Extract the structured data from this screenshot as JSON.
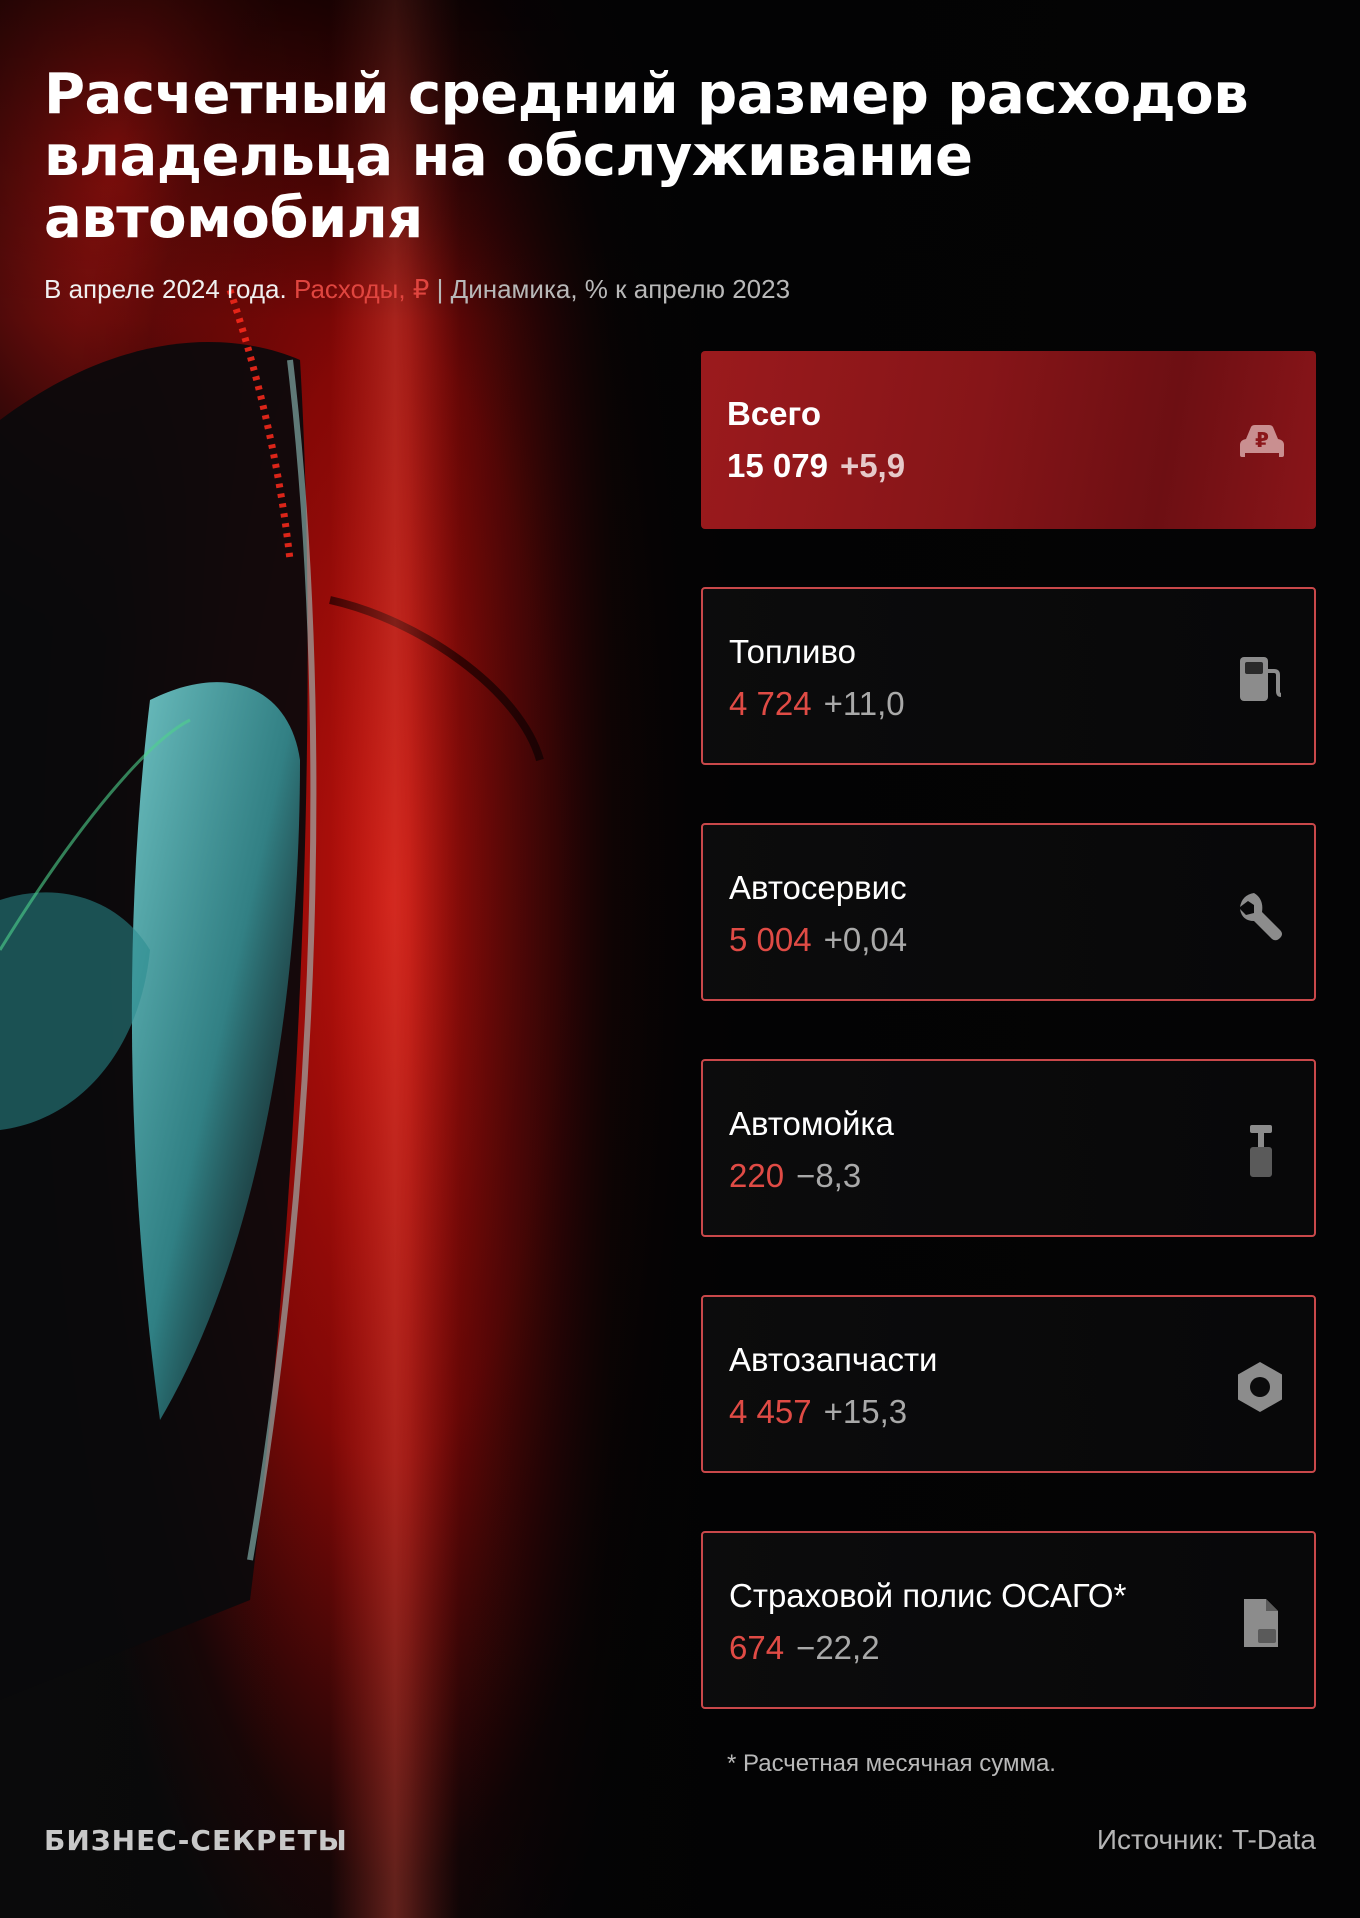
{
  "header": {
    "title": "Расчетный средний размер расходов владельца на обслуживание автомобиля",
    "subtitle_prefix": "В апреле 2024 года.",
    "subtitle_accent": "Расходы, ₽",
    "subtitle_separator": "|",
    "subtitle_suffix": "Динамика, % к апрелю 2023"
  },
  "cards": [
    {
      "label": "Всего",
      "value": "15 079",
      "change": "+5,9",
      "icon": "ruble-car-icon"
    },
    {
      "label": "Топливо",
      "value": "4 724",
      "change": "+11,0",
      "icon": "fuel-pump-icon"
    },
    {
      "label": "Автосервис",
      "value": "5 004",
      "change": "+0,04",
      "icon": "wrench-icon"
    },
    {
      "label": "Автомойка",
      "value": "220",
      "change": "−8,3",
      "icon": "spray-bottle-icon"
    },
    {
      "label": "Автозапчасти",
      "value": "4 457",
      "change": "+15,3",
      "icon": "hex-nut-icon"
    },
    {
      "label": "Страховой полис ОСАГО*",
      "value": "674",
      "change": "−22,2",
      "icon": "document-icon"
    }
  ],
  "footnote": "* Расчетная месячная сумма.",
  "brand": "БИЗНЕС-СЕКРЕТЫ",
  "source": "Источник: T-Data",
  "colors": {
    "accent": "#e04b45",
    "total_card": "#8b161a",
    "border": "#c9484a",
    "background": "#050506"
  }
}
